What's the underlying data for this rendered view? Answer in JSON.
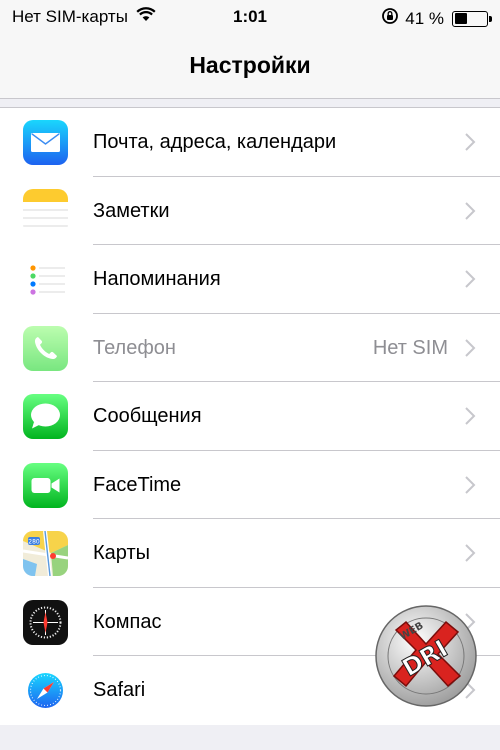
{
  "status_bar": {
    "carrier": "Нет SIM-карты",
    "time": "1:01",
    "battery_percent_label": "41 %",
    "battery_level": 0.41
  },
  "nav": {
    "title": "Настройки"
  },
  "settings": {
    "items": [
      {
        "label": "Почта, адреса, календари",
        "icon": "mail-icon",
        "detail": ""
      },
      {
        "label": "Заметки",
        "icon": "notes-icon",
        "detail": ""
      },
      {
        "label": "Напоминания",
        "icon": "reminders-icon",
        "detail": ""
      },
      {
        "label": "Телефон",
        "icon": "phone-icon",
        "detail": "Нет SIM"
      },
      {
        "label": "Сообщения",
        "icon": "messages-icon",
        "detail": ""
      },
      {
        "label": "FaceTime",
        "icon": "facetime-icon",
        "detail": ""
      },
      {
        "label": "Карты",
        "icon": "maps-icon",
        "detail": ""
      },
      {
        "label": "Компас",
        "icon": "compass-icon",
        "detail": ""
      },
      {
        "label": "Safari",
        "icon": "safari-icon",
        "detail": ""
      }
    ]
  },
  "watermark": {
    "text_top": "WEB",
    "text_main": "DRI"
  },
  "colors": {
    "accent": "#007aff",
    "separator": "#c8c7cc",
    "background": "#efeff4",
    "secondary_text": "#8e8e93",
    "messages_green": "#4cd964",
    "watermark_red": "#d9231f"
  }
}
